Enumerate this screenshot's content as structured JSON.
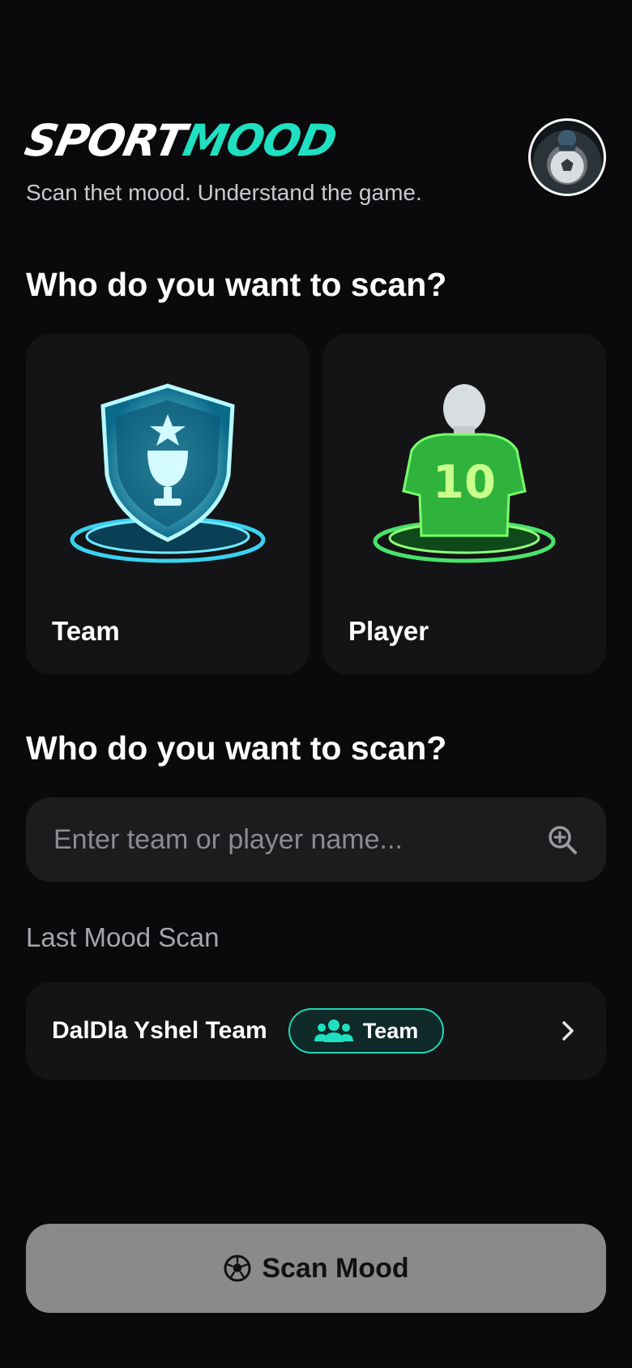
{
  "header": {
    "logo_part1": "SPORT",
    "logo_part2": "MOOD",
    "tagline": "Scan thet mood. Understand the game.",
    "avatar_icon": "soccer-ball-avatar"
  },
  "choose": {
    "title": "Who do you want to scan?",
    "options": [
      {
        "label": "Team",
        "icon": "trophy-shield-icon"
      },
      {
        "label": "Player",
        "icon": "player-jersey-icon",
        "jersey_number": "10"
      }
    ]
  },
  "search": {
    "title": "Who do you want to scan?",
    "placeholder": "Enter team or player name...",
    "icon": "search-plus-icon"
  },
  "last_scan": {
    "label": "Last Mood Scan",
    "item": {
      "name": "DalDla Yshel Team",
      "badge": "Team",
      "badge_icon": "team-icon"
    }
  },
  "cta": {
    "label": "Scan Mood",
    "icon": "soccer-ball-icon"
  },
  "colors": {
    "accent": "#1fe0c0",
    "background": "#0a0a0c",
    "card": "#141416",
    "button": "#8a8a8c"
  }
}
